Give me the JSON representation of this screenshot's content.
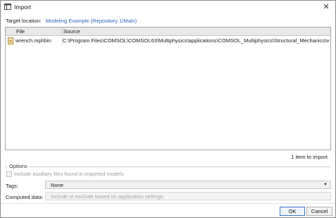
{
  "window": {
    "title": "Import",
    "title_icon": "import-dialog-icon",
    "close_icon": "close-icon"
  },
  "target": {
    "label": "Target location:",
    "value": "Modeling Example (Repository 1/Main)"
  },
  "table": {
    "columns": [
      "File",
      "Source"
    ],
    "rows": [
      {
        "icon": "mph-file-icon",
        "file": "wrench.mphbin",
        "source": "C:\\Program Files\\COMSOL\\COMSOL63\\Multiphysics\\applications\\COMSOL_Multiphysics\\Structural_Mechanics\\wrench..."
      }
    ]
  },
  "summary": {
    "count_text": "1 item to import."
  },
  "options": {
    "title": "Options",
    "include_aux_label": "Include auxiliary files found in imported models",
    "include_aux_checked": false,
    "include_aux_enabled": false
  },
  "tags": {
    "label": "Tags:",
    "value": "None"
  },
  "computed": {
    "label": "Computed data:",
    "value": "Include or exclude based on application settings",
    "enabled": false
  },
  "buttons": {
    "ok": "OK",
    "cancel": "Cancel"
  },
  "colors": {
    "link": "#2c64b6",
    "header_bg": "#e8e8e8",
    "disabled_text": "#9c9c9c",
    "default_button_border": "#3a78c8"
  }
}
